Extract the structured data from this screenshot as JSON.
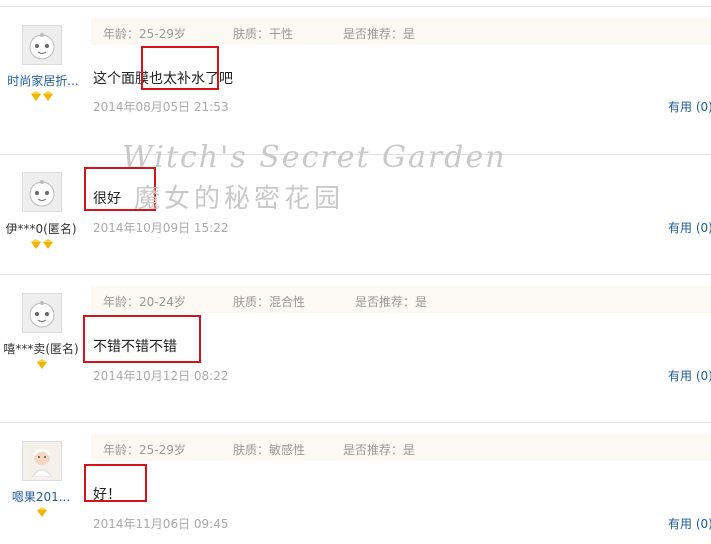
{
  "reviews": [
    {
      "username": "时尚家居折...",
      "username_link": true,
      "medals": 2,
      "avatar": "cartoon-face-icon",
      "age": "年龄：25-29岁",
      "skin": "肤质：干性",
      "recommend": "是否推荐：是",
      "content": "这个面膜也太补水了吧",
      "date": "2014年08月05日 21:53",
      "useful": "有用 (0)"
    },
    {
      "username": "伊***0(匿名)",
      "username_link": false,
      "medals": 2,
      "avatar": "cartoon-face-icon",
      "content": "很好",
      "date": "2014年10月09日 15:22",
      "useful": "有用 (0)"
    },
    {
      "username": "嘻***卖(匿名)",
      "username_link": false,
      "medals": 1,
      "avatar": "cartoon-face-icon",
      "age": "年龄：20-24岁",
      "skin": "肤质：混合性",
      "recommend": "是否推荐：是",
      "content": "不错不错不错",
      "date": "2014年10月12日 08:22",
      "useful": "有用 (0)"
    },
    {
      "username": "嗯果201...",
      "username_link": true,
      "medals": 1,
      "avatar": "baby-photo-avatar",
      "age": "年龄：25-29岁",
      "skin": "肤质：敏感性",
      "recommend": "是否推荐：是",
      "content": "好！",
      "date": "2014年11月06日 09:45",
      "useful": "有用 (0)"
    }
  ],
  "watermark": {
    "line1": "Witch's Secret Garden",
    "line2": "魔女的秘密花园"
  },
  "colors": {
    "highlight_box": "#d6121a",
    "link": "#1e5b9e",
    "info_bar": "#fcf9f3",
    "medal": "#f2b600"
  }
}
